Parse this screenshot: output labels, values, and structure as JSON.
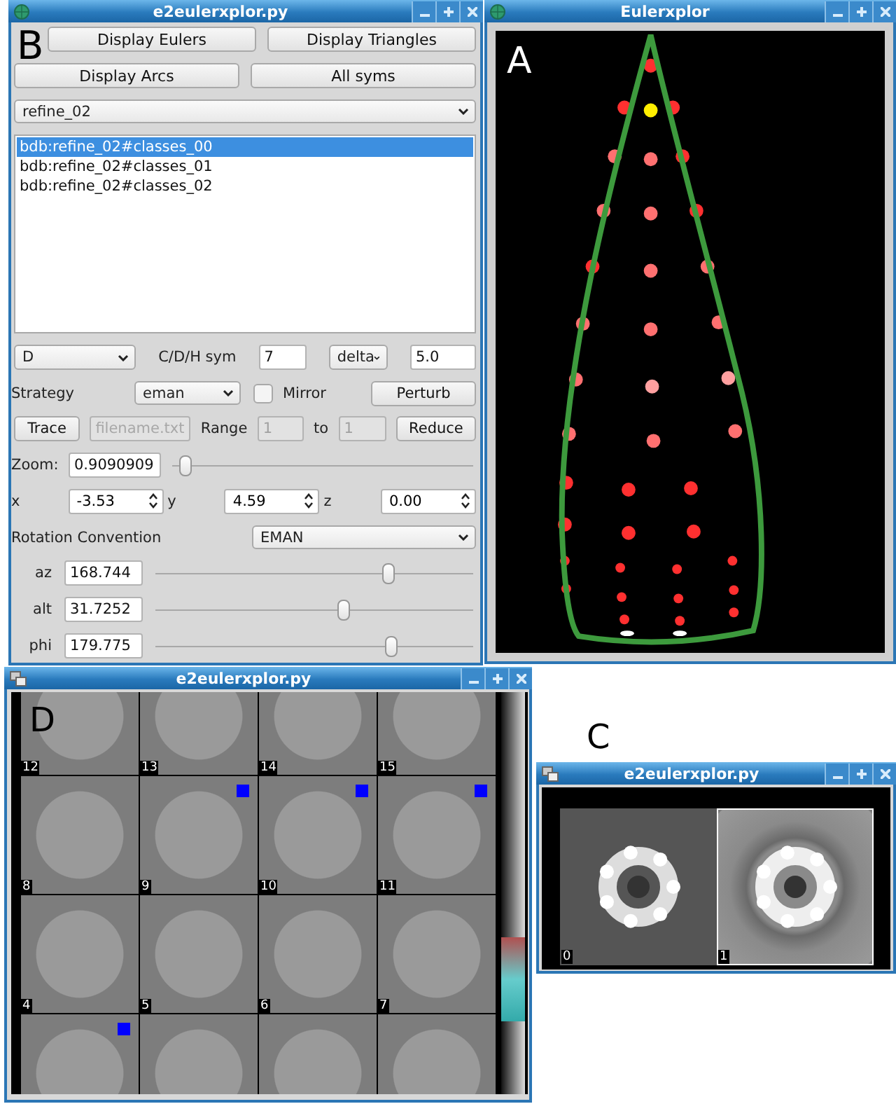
{
  "eulers_window": {
    "title": "e2eulerxplor.py",
    "panel_label": "B",
    "buttons": [
      "Display Eulers",
      "Display Triangles",
      "Display Arcs",
      "All syms"
    ],
    "dataset": "refine_02",
    "results": [
      {
        "label": "bdb:refine_02#classes_00",
        "selected": true
      },
      {
        "label": "bdb:refine_02#classes_01",
        "selected": false
      },
      {
        "label": "bdb:refine_02#classes_02",
        "selected": false
      }
    ],
    "symmetry": {
      "type": "D",
      "label": "C/D/H sym",
      "value": "7",
      "sampling": "delta",
      "sampling_value": "5.0"
    },
    "strategy": {
      "label": "Strategy",
      "value": "eman",
      "mirror": {
        "label": "Mirror",
        "checked": false
      },
      "perturb": "Perturb"
    },
    "trace": {
      "button": "Trace",
      "file": {
        "placeholder": "filename.txt",
        "disabled": true
      },
      "range_label": "Range",
      "from": {
        "value": "1",
        "disabled": true
      },
      "to_label": "to",
      "to": {
        "value": "1",
        "disabled": true
      },
      "reduce": "Reduce"
    },
    "zoom": {
      "label": "Zoom:",
      "value": "0.9090909",
      "level": 0.04
    },
    "position": [
      {
        "label": "x",
        "value": "-3.53"
      },
      {
        "label": "y",
        "value": "4.59"
      },
      {
        "label": "z",
        "value": "0.00"
      }
    ],
    "rotation": {
      "label": "Rotation Convention",
      "value": "EMAN"
    },
    "angles": [
      {
        "label": "az",
        "value": "168.744",
        "level": 0.73
      },
      {
        "label": "alt",
        "value": "31.7252",
        "level": 0.59
      },
      {
        "label": "phi",
        "value": "179.775",
        "level": 0.74
      }
    ]
  },
  "viewer_window": {
    "title": "Eulerxplor",
    "panel_label": "A"
  },
  "particles_window": {
    "title": "e2eulerxplor.py",
    "panel_label": "D",
    "tiles": [
      {
        "index": "12",
        "marked": false
      },
      {
        "index": "13",
        "marked": false
      },
      {
        "index": "14",
        "marked": false
      },
      {
        "index": "15",
        "marked": false
      },
      {
        "index": "8",
        "marked": false
      },
      {
        "index": "9",
        "marked": true
      },
      {
        "index": "10",
        "marked": true
      },
      {
        "index": "11",
        "marked": true
      },
      {
        "index": "4",
        "marked": false
      },
      {
        "index": "5",
        "marked": false
      },
      {
        "index": "6",
        "marked": false
      },
      {
        "index": "7",
        "marked": false
      },
      {
        "marked": true
      },
      {
        "marked": false
      },
      {
        "marked": false
      },
      {
        "marked": false
      }
    ]
  },
  "averages_window": {
    "title": "e2eulerxplor.py",
    "panel_label": "C",
    "images": [
      {
        "index": "0",
        "kind": "projection",
        "selected": false
      },
      {
        "index": "1",
        "kind": "average",
        "selected": true
      }
    ]
  }
}
